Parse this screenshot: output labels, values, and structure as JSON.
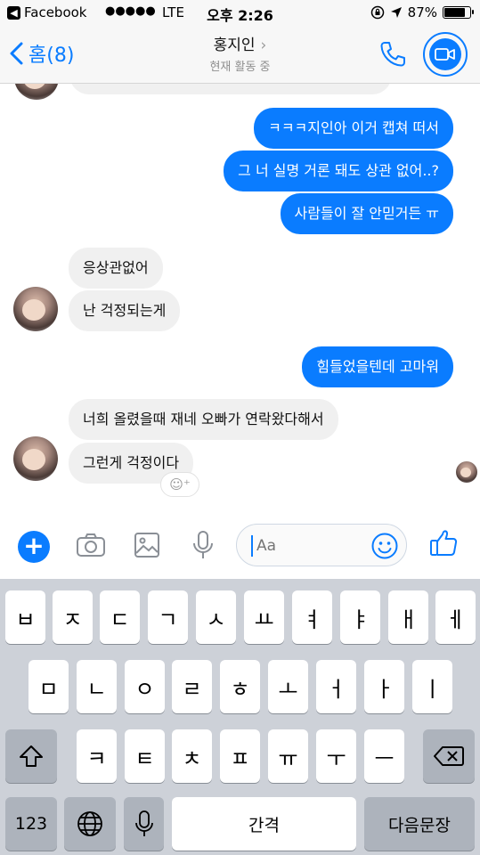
{
  "status_bar": {
    "back_app": "Facebook",
    "signal": "●●●●●",
    "carrier": "LTE",
    "time": "오후 2:26",
    "battery": "87%",
    "battery_level": 0.87
  },
  "header": {
    "back_label": "홈(8)",
    "contact_name": "홍지인",
    "presence": "현재 활동 중",
    "icons": [
      "chevron-left-icon",
      "chevron-right-icon",
      "phone-icon",
      "video-camera-icon"
    ]
  },
  "messages": [
    {
      "side": "out",
      "text": "ㅋㅋㅋ지인아 이거 캡쳐 떠서"
    },
    {
      "side": "out",
      "text": "그 너 실명 거론 돼도 상관 없어..?"
    },
    {
      "side": "out",
      "text": "사람들이 잘 안믿거든 ㅠ"
    },
    {
      "side": "in",
      "text": "응상관없어"
    },
    {
      "side": "in",
      "text": "난 걱정되는게"
    },
    {
      "side": "out",
      "text": "힘들었을텐데 고마워"
    },
    {
      "side": "in",
      "text": "너희 올렸을때 재네 오빠가 연락왔다해서"
    },
    {
      "side": "in",
      "text": "그런게 걱정이다"
    }
  ],
  "composer": {
    "placeholder": "Aa",
    "icons": [
      "plus-icon",
      "camera-icon",
      "image-icon",
      "microphone-icon",
      "emoji-icon",
      "thumbs-up-icon"
    ]
  },
  "keyboard": {
    "row1": [
      "ㅂ",
      "ㅈ",
      "ㄷ",
      "ㄱ",
      "ㅅ",
      "ㅛ",
      "ㅕ",
      "ㅑ",
      "ㅐ",
      "ㅔ"
    ],
    "row2": [
      "ㅁ",
      "ㄴ",
      "ㅇ",
      "ㄹ",
      "ㅎ",
      "ㅗ",
      "ㅓ",
      "ㅏ",
      "ㅣ"
    ],
    "row3": [
      "ㅋ",
      "ㅌ",
      "ㅊ",
      "ㅍ",
      "ㅠ",
      "ㅜ",
      "ㅡ"
    ],
    "numbers_key": "123",
    "space_key": "간격",
    "return_key": "다음문장"
  },
  "colors": {
    "accent": "#0a7cff",
    "incoming_bubble": "#f0f0f0",
    "keyboard_bg": "#cdd1d8"
  }
}
